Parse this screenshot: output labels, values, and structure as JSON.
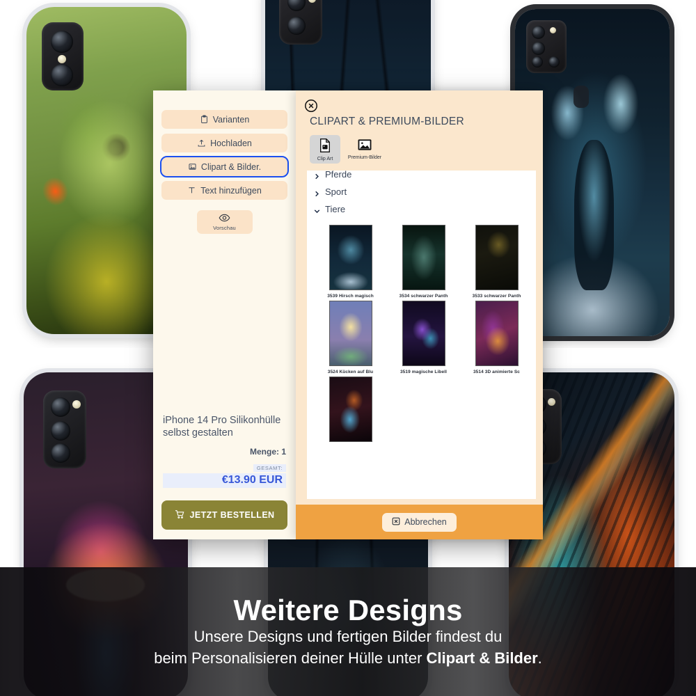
{
  "background": {
    "phones": [
      {
        "name": "lizard-dragon-case",
        "art": "art-lizard",
        "camera": "dual-vertical"
      },
      {
        "name": "dark-forest-case",
        "art": "art-forest",
        "camera": "dual-square"
      },
      {
        "name": "glowing-stag-case",
        "art": "art-stag",
        "camera": "quad-square"
      },
      {
        "name": "neon-mushroom-case",
        "art": "art-mushroom",
        "camera": "triple-vertical"
      },
      {
        "name": "dark-figure-case",
        "art": "art-dark",
        "camera": "none"
      },
      {
        "name": "fire-ice-tiger-case",
        "art": "art-tiger",
        "camera": "triple-vertical"
      }
    ]
  },
  "configurator": {
    "tools": [
      {
        "label": "Varianten",
        "icon": "clipboard-icon",
        "active": false
      },
      {
        "label": "Hochladen",
        "icon": "upload-icon",
        "active": false
      },
      {
        "label": "Clipart & Bilder.",
        "icon": "image-icon",
        "active": true
      },
      {
        "label": "Text hinzufügen",
        "icon": "text-icon",
        "active": false
      }
    ],
    "preview": {
      "label": "Vorschau",
      "icon": "eye-icon"
    },
    "product": {
      "title": "iPhone 14 Pro Silikonhülle selbst gestalten",
      "quantity_label": "Menge: 1",
      "total_label": "GESAMT:",
      "total_value": "€13.90 EUR"
    },
    "order_button": {
      "label": "JETZT BESTELLEN",
      "icon": "cart-icon"
    },
    "colors": {
      "panel_bg": "#fdf8ec",
      "tool_bg": "#fbe3c8",
      "active_outline": "#1a4ff0",
      "order_btn": "#8a8436",
      "price": "#3757d8"
    }
  },
  "modal": {
    "title": "CLIPART & PREMIUM-BILDER",
    "close_icon": "close-circle-icon",
    "tabs": [
      {
        "label": "Clip Art",
        "icon": "file-image-icon",
        "selected": true
      },
      {
        "label": "Premium-Bilder",
        "icon": "photo-icon",
        "selected": false
      }
    ],
    "categories": [
      {
        "label": "Pferde",
        "expanded": false,
        "clipped": true
      },
      {
        "label": "Sport",
        "expanded": false,
        "clipped": false
      },
      {
        "label": "Tiere",
        "expanded": true,
        "clipped": false
      }
    ],
    "thumbnails": [
      {
        "caption": "3539 Hirsch magisch",
        "art": "t-stag"
      },
      {
        "caption": "3534 schwarzer Panth",
        "art": "t-wolf"
      },
      {
        "caption": "3533 schwarzer Panth",
        "art": "t-panther"
      },
      {
        "caption": "3524 Kücken auf Blu",
        "art": "t-chick"
      },
      {
        "caption": "3519 magische Libell",
        "art": "t-dragon"
      },
      {
        "caption": "3514 3D animierte Sc",
        "art": "t-snail"
      }
    ],
    "partial_row": [
      {
        "caption": "",
        "art": "t-bird"
      }
    ],
    "cancel_button": {
      "label": "Abbrechen",
      "icon": "cancel-box-icon"
    },
    "colors": {
      "modal_bg": "#fbe7cd",
      "footer_bg": "#efa242",
      "list_bg": "#ffffff"
    }
  },
  "banner": {
    "title": "Weitere Designs",
    "line1": "Unsere Designs und fertigen Bilder findest du",
    "line2_prefix": "beim Personalisieren deiner Hülle unter ",
    "line2_bold": "Clipart & Bilder",
    "line2_suffix": "."
  }
}
